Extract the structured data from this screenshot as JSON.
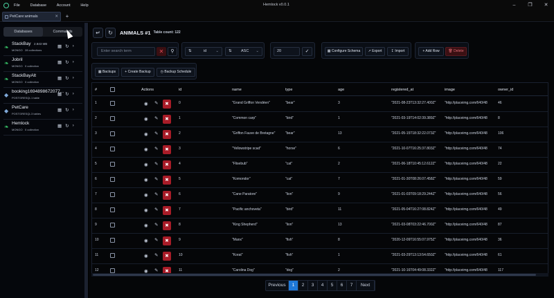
{
  "app": {
    "title": "Hemlock v0.0.1",
    "menu": [
      "File",
      "Database",
      "Account",
      "Help"
    ]
  },
  "tabs": [
    {
      "label": "PetCare:animals"
    }
  ],
  "sidebar": {
    "segments": [
      "Databases",
      "Commands"
    ],
    "databases": [
      {
        "name": "StackBay",
        "size": "2.843 MB",
        "type": "MONGO",
        "collections": "28 collections",
        "icon": "leaf",
        "color": "#3bd16f"
      },
      {
        "name": "Jobril",
        "size": "",
        "type": "MONGO",
        "collections": "0 collection",
        "icon": "leaf",
        "color": "#3bd16f"
      },
      {
        "name": "StackBayAlt",
        "size": "",
        "type": "MONGO",
        "collections": "0 collection",
        "icon": "leaf",
        "color": "#3bd16f"
      },
      {
        "name": "booking1694898672077...",
        "size": "",
        "type": "POSTGRESQL",
        "collections": "1 table",
        "icon": "elephant",
        "color": "#7fa8d8"
      },
      {
        "name": "PetCare",
        "size": "",
        "type": "POSTGRESQL",
        "collections": "3 tables",
        "icon": "elephant",
        "color": "#7fa8d8"
      },
      {
        "name": "Hemlock",
        "size": "",
        "type": "MONGO",
        "collections": "0 collection",
        "icon": "leaf",
        "color": "#3bd16f"
      }
    ]
  },
  "main": {
    "collection_title": "ANIMALS #1",
    "table_count": "Table count: 122",
    "search_placeholder": "Enter search term",
    "sort_field": "id",
    "sort_order": "ASC",
    "limit": "20",
    "buttons": {
      "configure_schema": "Configure Schema",
      "export": "Export",
      "import": "Import",
      "add_row": "+ Add Row",
      "delete": "Delete",
      "backups": "Backups",
      "create_backup": "+ Create Backup",
      "backup_schedule": "Backup Schedule"
    },
    "columns": [
      "#",
      "",
      "Actions",
      "id",
      "name",
      "type",
      "age",
      "registered_at",
      "image",
      "owner_id"
    ],
    "rows": [
      [
        "1",
        "0",
        "\"Grand Griffon Vendéen\"",
        "\"bear\"",
        "3",
        "\"2021-08-23T13:32:27.400Z\"",
        "\"http://placeimg.com/640/48",
        "46"
      ],
      [
        "2",
        "1",
        "\"Common carp\"",
        "\"bird\"",
        "1",
        "\"2021-03-19T14:02:39.389Z\"",
        "\"http://placeimg.com/640/48",
        "8"
      ],
      [
        "3",
        "2",
        "\"Griffon Fauve de Bretagne\"",
        "\"bear\"",
        "13",
        "\"2021-05-15T18:32:22.073Z\"",
        "\"http://placeimg.com/640/48",
        "106"
      ],
      [
        "4",
        "3",
        "\"Yellowstripe scad\"",
        "\"horse\"",
        "6",
        "\"2021-10-07T16:25:37.803Z\"",
        "\"http://placeimg.com/640/48",
        "74"
      ],
      [
        "5",
        "4",
        "\"Flisebub\"",
        "\"cat\"",
        "2",
        "\"2021-06-18T10:45:12.612Z\"",
        "\"http://placeimg.com/640/48",
        "22"
      ],
      [
        "6",
        "5",
        "\"Komondor\"",
        "\"cat\"",
        "7",
        "\"2021-01-30T08:26:07.458Z\"",
        "\"http://placeimg.com/640/48",
        "59"
      ],
      [
        "7",
        "6",
        "\"Cane Paratore\"",
        "\"lion\"",
        "9",
        "\"2021-01-03T09:18:29.244Z\"",
        "\"http://placeimg.com/640/48",
        "56"
      ],
      [
        "8",
        "7",
        "\"Pacific anchoveta\"",
        "\"bird\"",
        "11",
        "\"2021-05-04T16:27:08.824Z\"",
        "\"http://placeimg.com/640/48",
        "49"
      ],
      [
        "9",
        "8",
        "\"King Shepherd\"",
        "\"lion\"",
        "13",
        "\"2021-03-08T03:22:46.700Z\"",
        "\"http://placeimg.com/640/48",
        "87"
      ],
      [
        "10",
        "9",
        "\"Manx\"",
        "\"fish\"",
        "8",
        "\"2020-12-09T16:55:07.975Z\"",
        "\"http://placeimg.com/640/48",
        "36"
      ],
      [
        "11",
        "10",
        "\"Korat\"",
        "\"fish\"",
        "1",
        "\"2021-03-29T13:13:54.650Z\"",
        "\"http://placeimg.com/640/48",
        "61"
      ],
      [
        "12",
        "11",
        "\"Carolina Dog\"",
        "\"dog\"",
        "2",
        "\"2021-10-16T04:49:08.332Z\"",
        "\"http://placeimg.com/640/48",
        "117"
      ]
    ],
    "pagination": [
      "Previous",
      "1",
      "2",
      "3",
      "4",
      "5",
      "6",
      "7",
      "Next"
    ],
    "current_page": "1"
  }
}
